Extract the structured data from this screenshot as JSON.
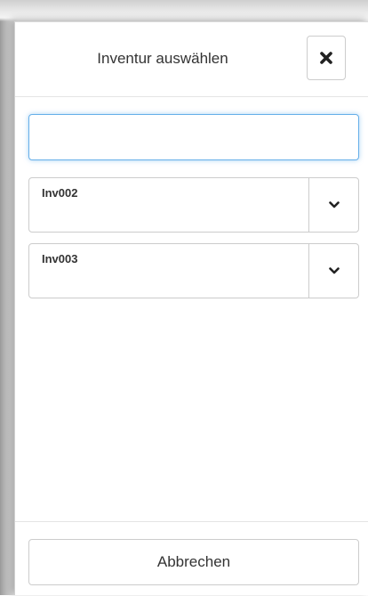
{
  "dialog": {
    "title": "Inventur auswählen",
    "close_icon": "close-icon"
  },
  "search": {
    "value": "",
    "placeholder": ""
  },
  "inventories": [
    {
      "label": "Inv002",
      "toggle_icon": "chevron-down-icon"
    },
    {
      "label": "Inv003",
      "toggle_icon": "chevron-down-icon"
    }
  ],
  "footer": {
    "cancel_label": "Abbrechen"
  }
}
